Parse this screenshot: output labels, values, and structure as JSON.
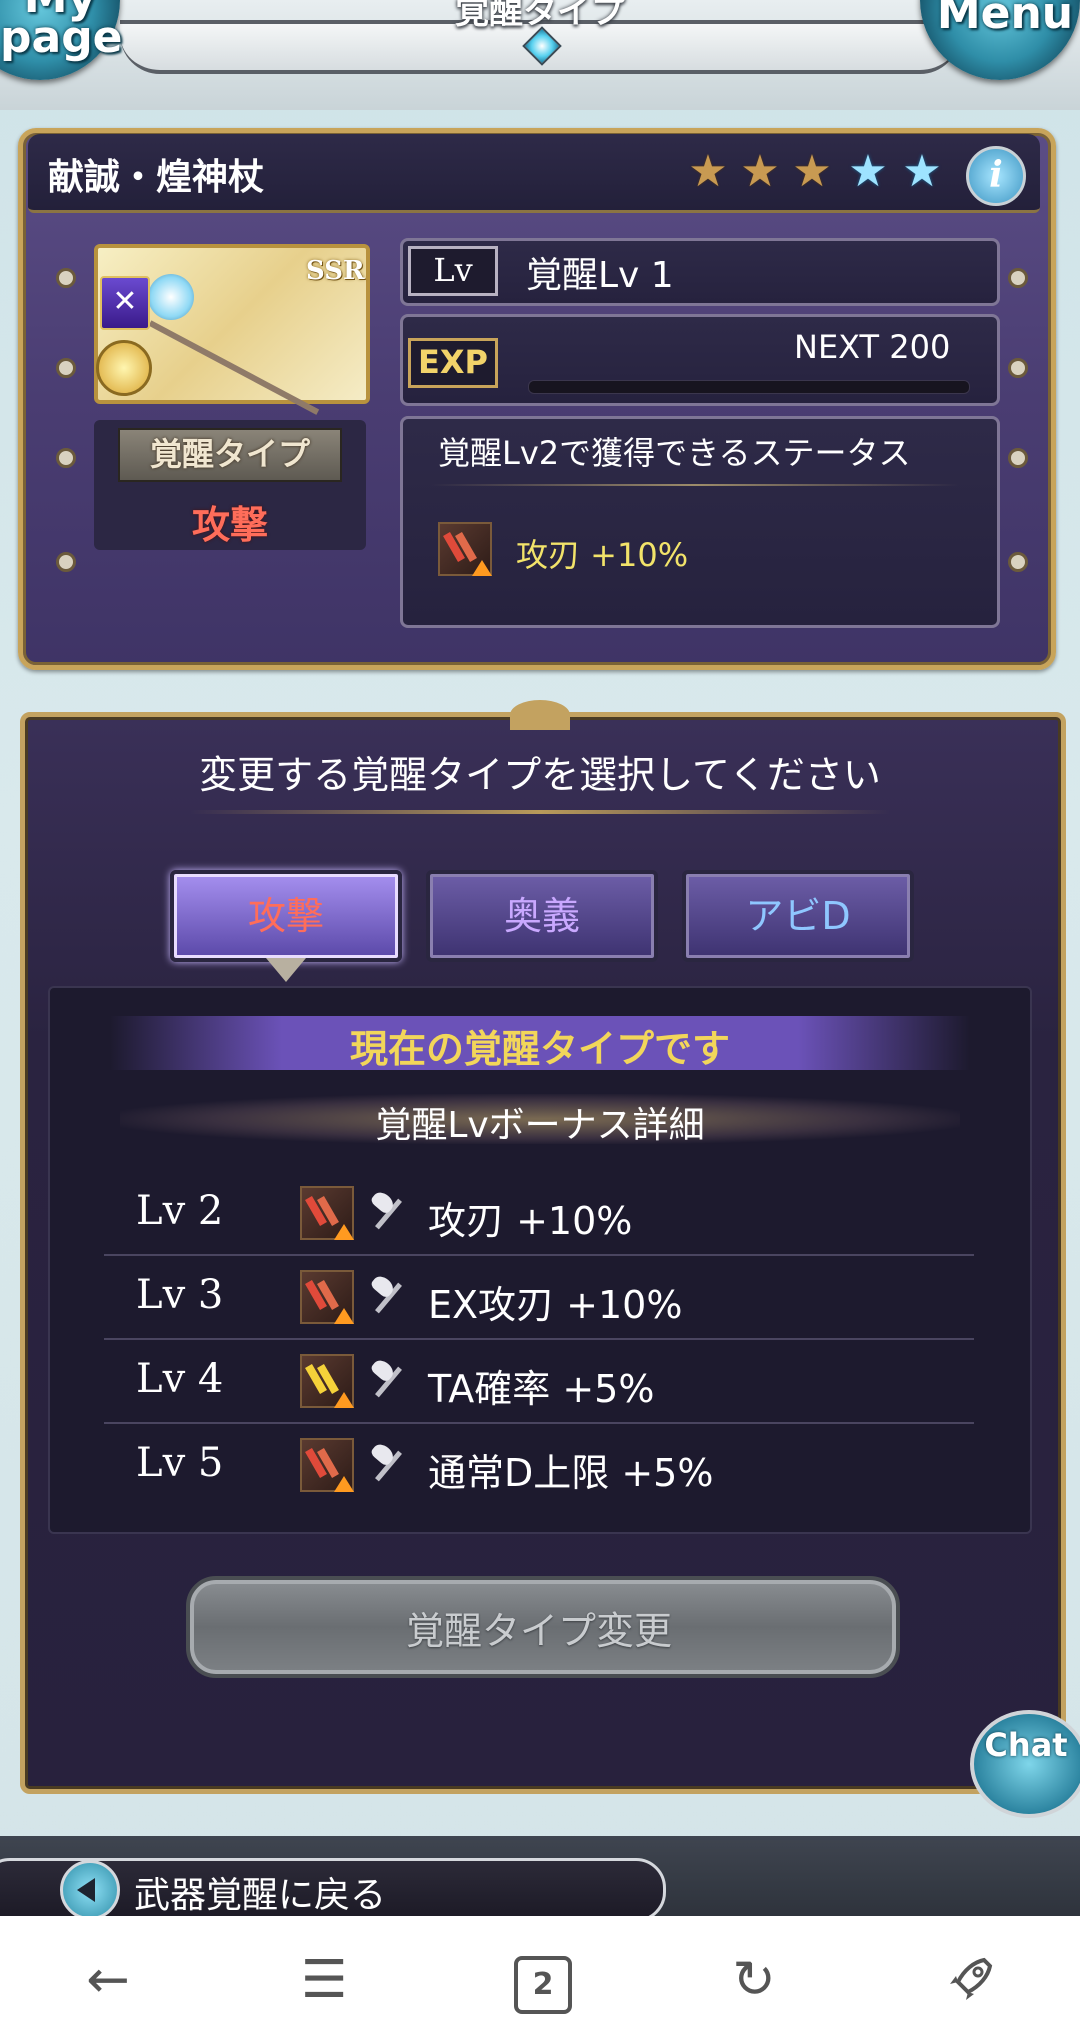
{
  "header": {
    "title": "覚醒タイプ",
    "mypage_label": "My page",
    "menu_label": "Menu"
  },
  "weapon": {
    "name": "献誠・煌神杖",
    "rarity": "SSR",
    "stars": {
      "filled": 3,
      "total": 5
    },
    "info_icon": "info-icon",
    "awaken_type_label": "覚醒タイプ",
    "awaken_type_value": "攻撃",
    "lv_badge": "Lv",
    "level_text": "覚醒Lv 1",
    "exp_badge": "EXP",
    "next_label": "NEXT 200",
    "exp_progress": 0,
    "next_status_title": "覚醒Lv2で獲得できるステータス",
    "next_status_skill": "攻刃 +10%"
  },
  "selection": {
    "title": "変更する覚醒タイプを選択してください",
    "types": [
      {
        "label": "攻撃",
        "active": true
      },
      {
        "label": "奥義",
        "active": false
      },
      {
        "label": "アビD",
        "active": false
      }
    ],
    "current_label": "現在の覚醒タイプです",
    "bonus_header": "覚醒Lvボーナス詳細",
    "bonuses": [
      {
        "lv": "Lv 2",
        "skill": "攻刃 +10%",
        "icon": "attack-up-icon"
      },
      {
        "lv": "Lv 3",
        "skill": "EX攻刃 +10%",
        "icon": "attack-up-icon"
      },
      {
        "lv": "Lv 4",
        "skill": "TA確率 +5%",
        "icon": "triple-attack-up-icon"
      },
      {
        "lv": "Lv 5",
        "skill": "通常D上限 +5%",
        "icon": "attack-up-icon"
      }
    ],
    "change_button": "覚醒タイプ変更",
    "chat_label": "Chat"
  },
  "back_label": "武器覚醒に戻る",
  "browser": {
    "back_icon": "←",
    "menu_icon": "☰",
    "tab_count": "2",
    "reload_icon": "↻",
    "rocket_icon": "rocket-icon"
  },
  "colors": {
    "panel_purple": "#4a3d72",
    "gold_border": "#c8a45a",
    "attack_red": "#ff6d5a",
    "highlight_yellow": "#f2d65a"
  }
}
